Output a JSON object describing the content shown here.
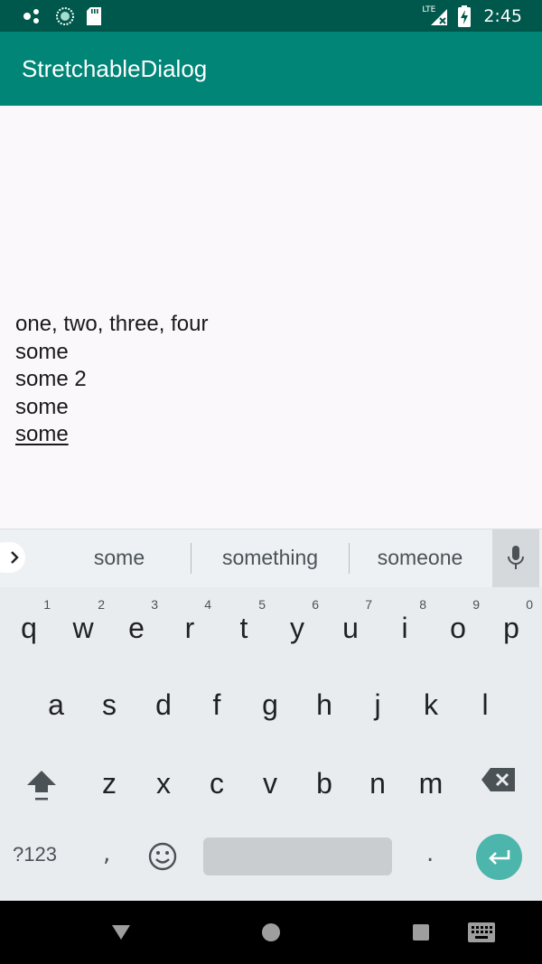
{
  "status_bar": {
    "time": "2:45",
    "network_label": "LTE",
    "icons": [
      "notification-dots-icon",
      "sync-icon",
      "sd-card-icon",
      "lte-signal-icon",
      "battery-charging-icon"
    ]
  },
  "app_bar": {
    "title": "StretchableDialog"
  },
  "content": {
    "lines": [
      "one, two, three, four",
      "some",
      "some 2",
      "some",
      "some"
    ]
  },
  "keyboard": {
    "suggestions": [
      "some",
      "something",
      "someone"
    ],
    "row1": [
      {
        "key": "q",
        "num": "1"
      },
      {
        "key": "w",
        "num": "2"
      },
      {
        "key": "e",
        "num": "3"
      },
      {
        "key": "r",
        "num": "4"
      },
      {
        "key": "t",
        "num": "5"
      },
      {
        "key": "y",
        "num": "6"
      },
      {
        "key": "u",
        "num": "7"
      },
      {
        "key": "i",
        "num": "8"
      },
      {
        "key": "o",
        "num": "9"
      },
      {
        "key": "p",
        "num": "0"
      }
    ],
    "row2": [
      "a",
      "s",
      "d",
      "f",
      "g",
      "h",
      "j",
      "k",
      "l"
    ],
    "row3": [
      "z",
      "x",
      "c",
      "v",
      "b",
      "n",
      "m"
    ],
    "symbols_label": "?123",
    "comma_label": ",",
    "period_label": ".",
    "accent_color": "#4db6ac"
  },
  "colors": {
    "status_bar": "#00574b",
    "app_bar": "#008577",
    "keyboard_bg": "#e9ecef"
  }
}
